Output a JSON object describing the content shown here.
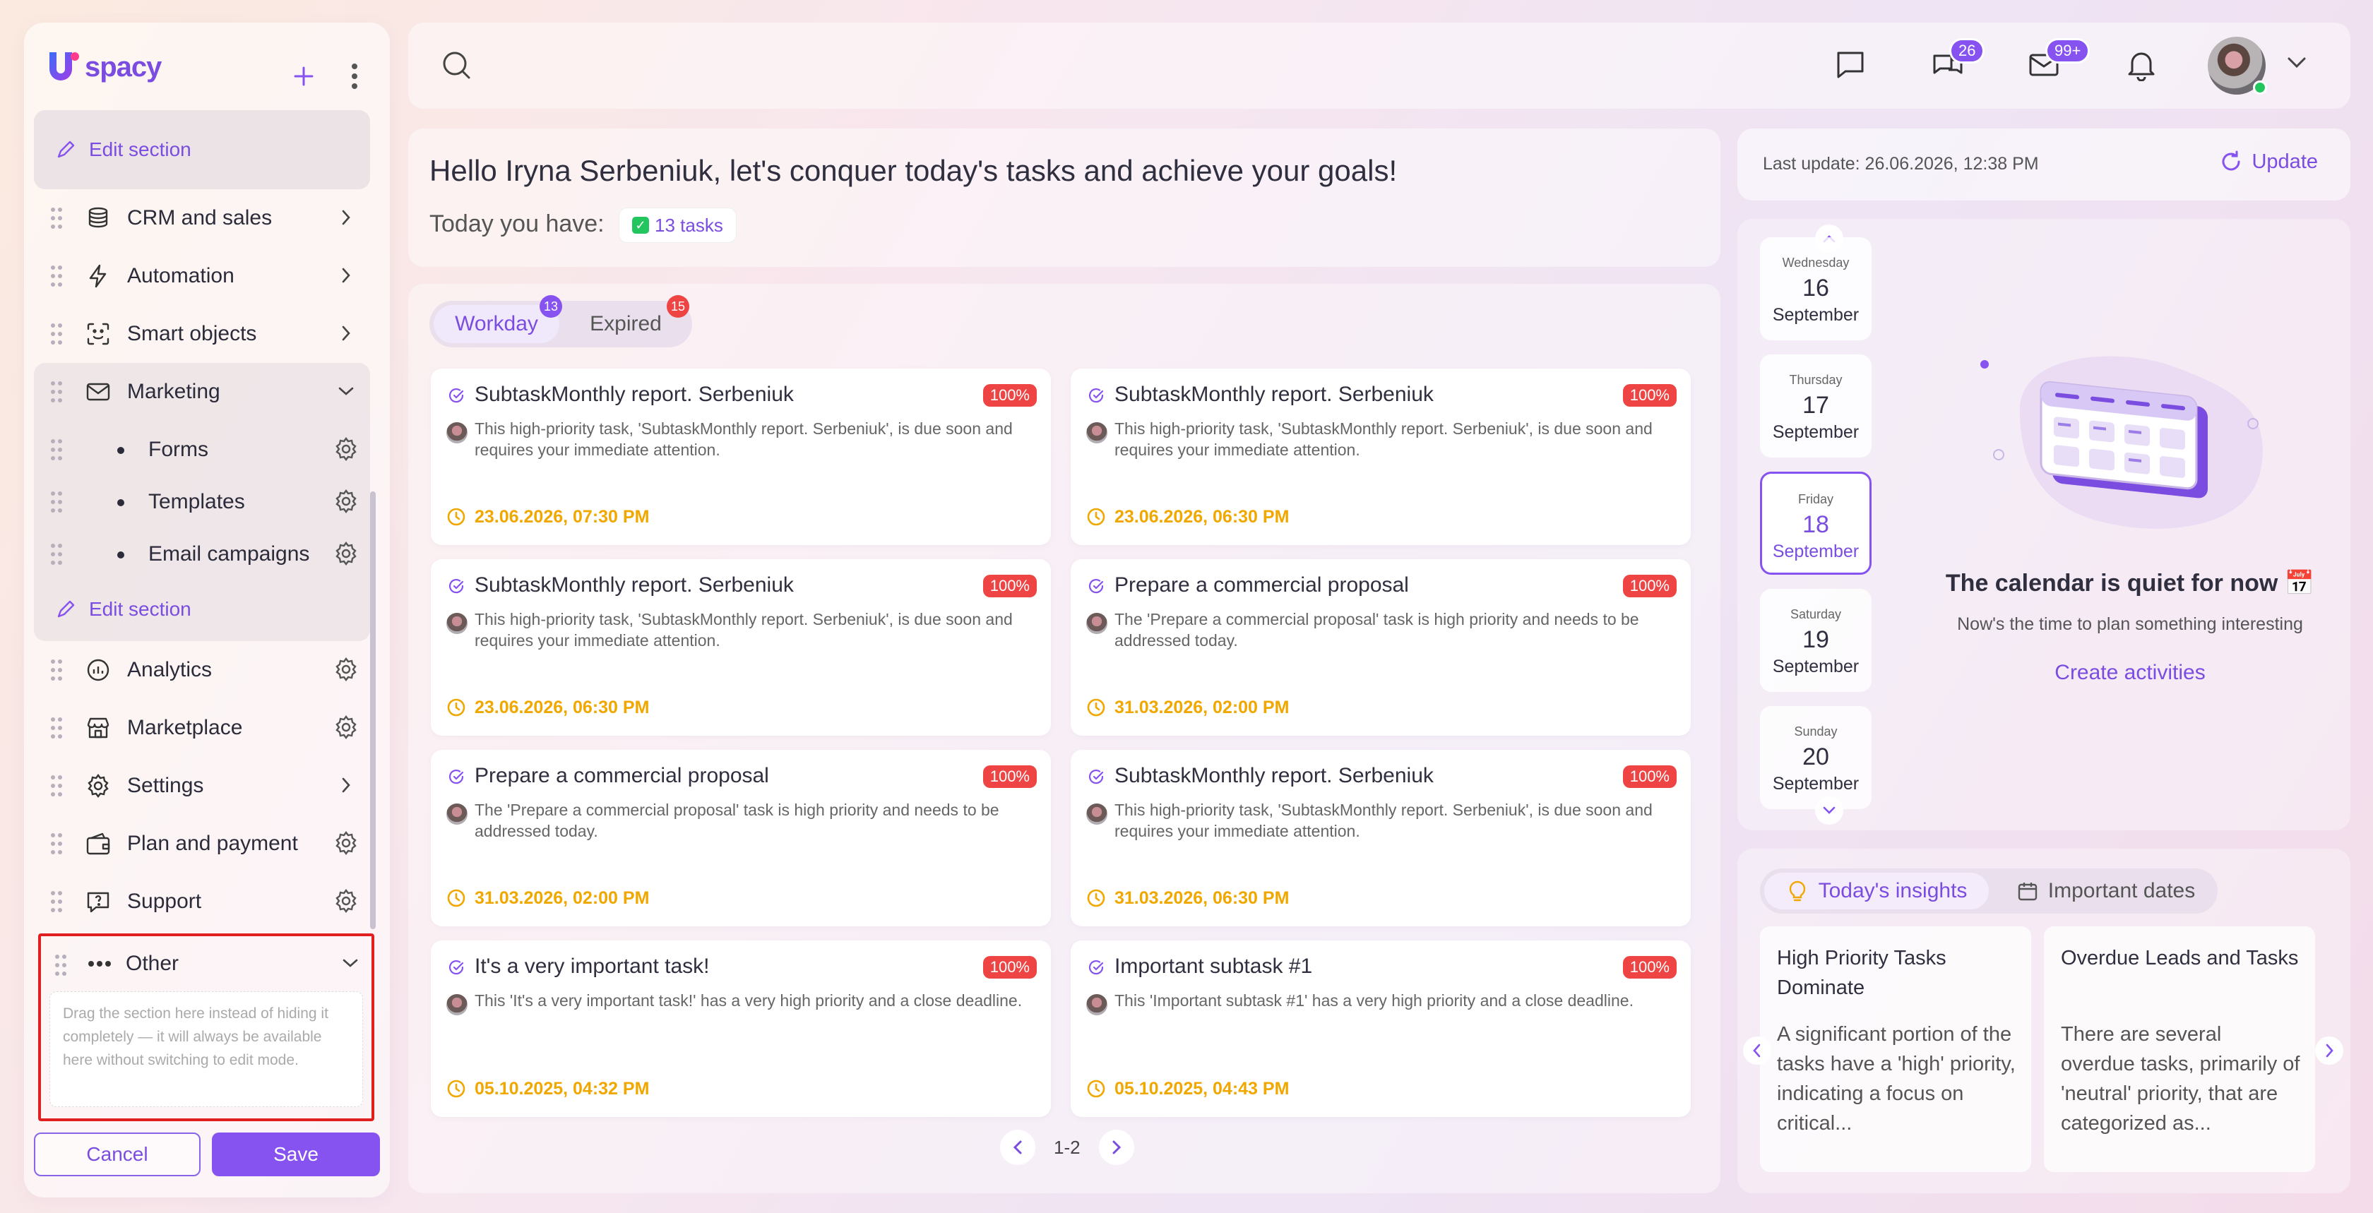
{
  "app": {
    "logo_u": "U",
    "logo_text": "spacy"
  },
  "sidebar": {
    "edit_section_label": "Edit section",
    "items": {
      "crm": "CRM and sales",
      "automation": "Automation",
      "smart_objects": "Smart objects",
      "marketing": "Marketing",
      "forms": "Forms",
      "templates": "Templates",
      "email_campaigns": "Email campaigns",
      "analytics": "Analytics",
      "marketplace": "Marketplace",
      "settings": "Settings",
      "plan_payment": "Plan and payment",
      "support": "Support",
      "other": "Other"
    },
    "other_hint": "Drag the section here instead of hiding it completely — it will always be available here without switching to edit mode.",
    "cancel_label": "Cancel",
    "save_label": "Save"
  },
  "topbar": {
    "chat_badge": "26",
    "mail_badge": "99+"
  },
  "greeting": {
    "title": "Hello Iryna Serbeniuk, let's conquer today's tasks and achieve your goals!",
    "today_label": "Today you have:",
    "tasks_count": "13 tasks"
  },
  "tasks": {
    "tabs": [
      {
        "label": "Workday",
        "badge": "13"
      },
      {
        "label": "Expired",
        "badge": "15"
      }
    ],
    "cards": [
      {
        "title": "SubtaskMonthly report. Serbeniuk",
        "pct": "100%",
        "desc": "This high-priority task, 'SubtaskMonthly report. Serbeniuk', is due soon and requires your immediate attention.",
        "date": "23.06.2026, 07:30 PM"
      },
      {
        "title": "SubtaskMonthly report. Serbeniuk",
        "pct": "100%",
        "desc": "This high-priority task, 'SubtaskMonthly report. Serbeniuk', is due soon and requires your immediate attention.",
        "date": "23.06.2026, 06:30 PM"
      },
      {
        "title": "SubtaskMonthly report. Serbeniuk",
        "pct": "100%",
        "desc": "This high-priority task, 'SubtaskMonthly report. Serbeniuk', is due soon and requires your immediate attention.",
        "date": "23.06.2026, 06:30 PM"
      },
      {
        "title": "Prepare a commercial proposal",
        "pct": "100%",
        "desc": "The 'Prepare a commercial proposal' task is high priority and needs to be addressed today.",
        "date": "31.03.2026, 02:00 PM"
      },
      {
        "title": "Prepare a commercial proposal",
        "pct": "100%",
        "desc": "The 'Prepare a commercial proposal' task is high priority and needs to be addressed today.",
        "date": "31.03.2026, 02:00 PM"
      },
      {
        "title": "SubtaskMonthly report. Serbeniuk",
        "pct": "100%",
        "desc": "This high-priority task, 'SubtaskMonthly report. Serbeniuk', is due soon and requires your immediate attention.",
        "date": "31.03.2026, 06:30 PM"
      },
      {
        "title": "It's a very important task!",
        "pct": "100%",
        "desc": "This 'It's a very important task!' has a very high priority and a close deadline.",
        "date": "05.10.2025, 04:32 PM"
      },
      {
        "title": "Important subtask #1",
        "pct": "100%",
        "desc": "This 'Important subtask #1' has a very high priority and a close deadline.",
        "date": "05.10.2025, 04:43 PM"
      }
    ],
    "pager": "1-2"
  },
  "right": {
    "last_update": "Last update: 26.06.2026, 12:38 PM",
    "update_label": "Update",
    "days": [
      {
        "name": "Wednesday",
        "num": "16",
        "month": "September"
      },
      {
        "name": "Thursday",
        "num": "17",
        "month": "September"
      },
      {
        "name": "Friday",
        "num": "18",
        "month": "September"
      },
      {
        "name": "Saturday",
        "num": "19",
        "month": "September"
      },
      {
        "name": "Sunday",
        "num": "20",
        "month": "September"
      }
    ],
    "empty_title": "The calendar is quiet for now 📅",
    "empty_sub": "Now's the time to plan something interesting",
    "create_label": "Create activities",
    "insights_tab": "Today's insights",
    "dates_tab": "Important dates",
    "insights": [
      {
        "title": "High Priority Tasks Dominate",
        "body": "A significant portion of the tasks have a 'high' priority, indicating a focus on critical..."
      },
      {
        "title": "Overdue Leads and Tasks",
        "body": "There are several overdue tasks, primarily of 'neutral' priority, that are categorized as..."
      }
    ]
  },
  "colors": {
    "accent": "#8652f0",
    "danger": "#ef4444",
    "date": "#f0a800"
  }
}
